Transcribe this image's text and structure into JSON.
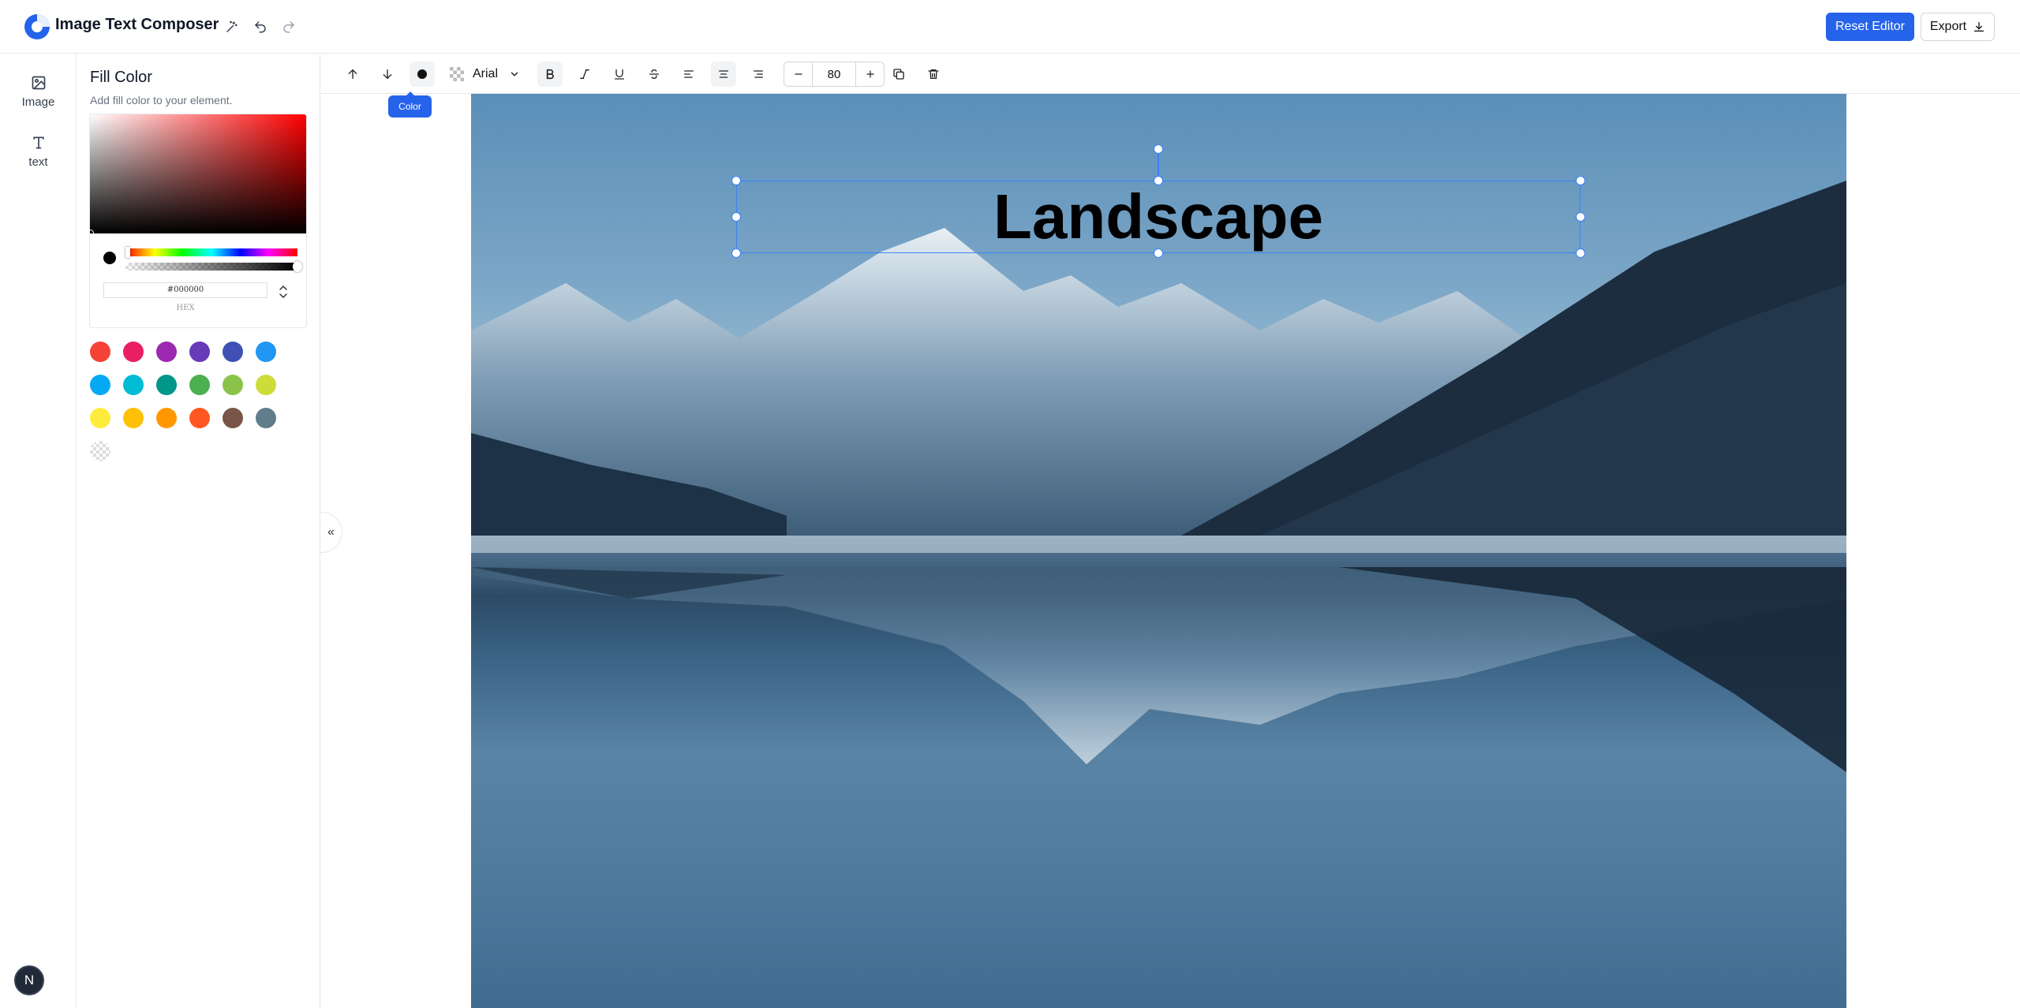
{
  "app": {
    "title": "Image Text Composer"
  },
  "header": {
    "reset_label": "Reset Editor",
    "export_label": "Export"
  },
  "rail": {
    "items": [
      {
        "label": "Image"
      },
      {
        "label": "text"
      }
    ],
    "avatar_letter": "N"
  },
  "panel": {
    "title": "Fill Color",
    "subtitle": "Add fill color to your element.",
    "hex_value": "#000000",
    "hex_label": "HEX",
    "swatches": [
      "#f44336",
      "#e91e63",
      "#9c27b0",
      "#673ab7",
      "#3f51b5",
      "#2196f3",
      "#03a9f4",
      "#00bcd4",
      "#009688",
      "#4caf50",
      "#8bc34a",
      "#cddc39",
      "#ffeb3b",
      "#ffc107",
      "#ff9800",
      "#ff5722",
      "#795548",
      "#607d8b",
      "transparent"
    ]
  },
  "toolbar": {
    "font_family": "Arial",
    "font_size": "80",
    "tooltip": "Color"
  },
  "canvas": {
    "text": "Landscape",
    "accent": "#3b82f6"
  }
}
